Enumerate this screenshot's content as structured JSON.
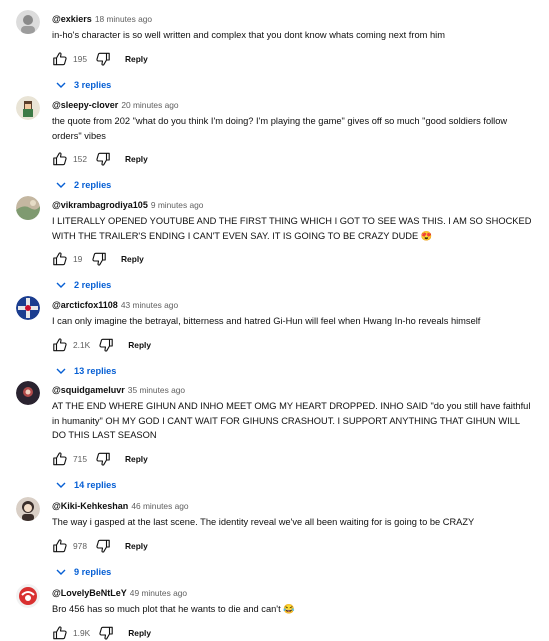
{
  "comments": [
    {
      "author": "@exkiers",
      "time": "18 minutes ago",
      "text": "in-ho's character is so well written and complex that you dont know whats coming next from him",
      "likes": "195",
      "reply_label": "Reply",
      "replies": "3 replies",
      "avatar_colors": [
        "#dcdcdc",
        "#8a8a8a"
      ]
    },
    {
      "author": "@sleepy-clover",
      "time": "20 minutes ago",
      "text": "the quote from 202 \"what do you think I'm doing?  I'm playing the game\" gives off so much \"good soldiers follow orders\" vibes",
      "likes": "152",
      "reply_label": "Reply",
      "replies": "2 replies",
      "avatar_colors": [
        "#e9e4d6",
        "#3d7a46"
      ]
    },
    {
      "author": "@vikrambagrodiya105",
      "time": "9 minutes ago",
      "text": "I LITERALLY OPENED YOUTUBE AND THE FIRST THING WHICH I GOT TO SEE WAS THIS. I AM SO SHOCKED WITH THE TRAILER'S ENDING I CAN'T EVEN SAY. IT IS GOING TO BE CRAZY DUDE 😍",
      "likes": "19",
      "reply_label": "Reply",
      "replies": "2 replies",
      "avatar_colors": [
        "#7f9a70",
        "#c4b7a1"
      ]
    },
    {
      "author": "@arcticfox1108",
      "time": "43 minutes ago",
      "text": "I can only imagine the betrayal, bitterness and hatred Gi-Hun will feel when Hwang In-ho reveals himself",
      "likes": "2.1K",
      "reply_label": "Reply",
      "replies": "13 replies",
      "avatar_colors": [
        "#1b3d8f",
        "#e8e8e8"
      ]
    },
    {
      "author": "@squidgameluvr",
      "time": "35 minutes ago",
      "text": "AT THE END WHERE GIHUN AND INHO MEET OMG MY HEART DROPPED. INHO SAID \"do you still have faithful in humanity\" OH MY GOD I CANT WAIT FOR GIHUNS CRASHOUT. I SUPPORT ANYTHING THAT GIHUN WILL DO THIS LAST SEASON",
      "likes": "715",
      "reply_label": "Reply",
      "replies": "14 replies",
      "avatar_colors": [
        "#2a2330",
        "#b04a4a"
      ]
    },
    {
      "author": "@Kiki-Kehkeshan",
      "time": "46 minutes ago",
      "text": "The way i gasped at the last scene. The identity reveal we've all been waiting for is going to be CRAZY",
      "likes": "978",
      "reply_label": "Reply",
      "replies": "9 replies",
      "avatar_colors": [
        "#d9cfc6",
        "#3a2e2a"
      ]
    },
    {
      "author": "@LovelyBeNtLeY",
      "time": "49 minutes ago",
      "text": "Bro 456 has so much plot that he wants to die and can't 😂",
      "likes": "1.9K",
      "reply_label": "Reply",
      "replies": "",
      "avatar_colors": [
        "#f2f2f2",
        "#d93030"
      ]
    }
  ],
  "icons": {
    "like": "thumbs-up-icon",
    "dislike": "thumbs-down-icon",
    "expand": "chevron-down-icon"
  },
  "colors": {
    "link": "#065fd4",
    "meta": "#606060",
    "text": "#0f0f0f"
  }
}
